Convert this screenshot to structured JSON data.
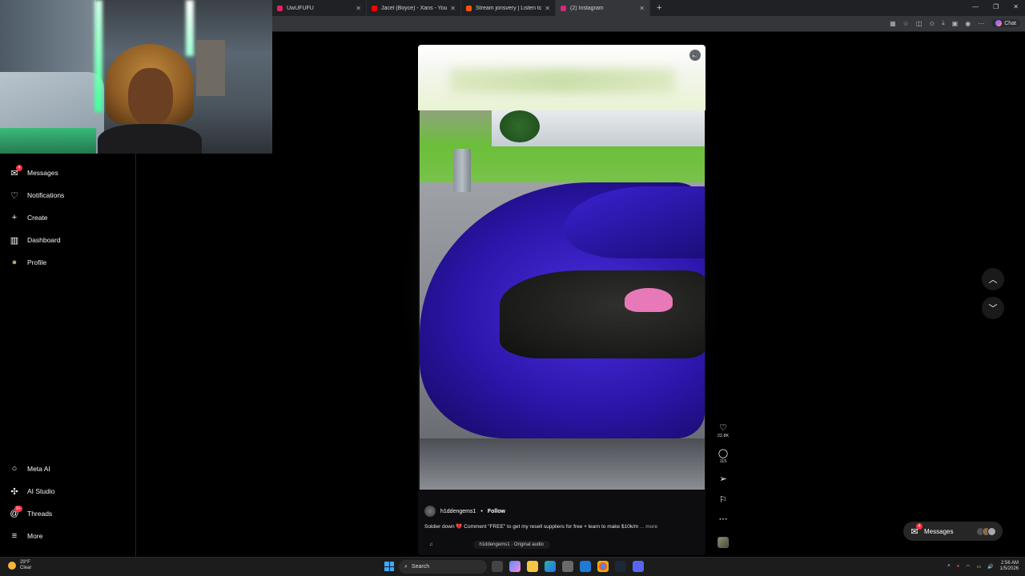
{
  "browser": {
    "tabs": [
      {
        "label": "UwUFUFU",
        "color": "#e0245e",
        "active": false
      },
      {
        "label": "Jacel (Boyce) - Xans - YouTube",
        "color": "#ff0000",
        "active": false
      },
      {
        "label": "Stream jonsvery | Listen to rap pl",
        "color": "#ff5500",
        "active": false
      },
      {
        "label": "(2) Instagram",
        "color": "#d62976",
        "active": true
      }
    ],
    "new_tab_symbol": "+",
    "chat_label": "Chat"
  },
  "sidebar": {
    "items": [
      {
        "label": "Messages",
        "icon": "messenger-icon",
        "glyph": "✉",
        "badge": "4"
      },
      {
        "label": "Notifications",
        "icon": "heart-icon",
        "glyph": "♡",
        "badge": ""
      },
      {
        "label": "Create",
        "icon": "plus-icon",
        "glyph": "+",
        "badge": ""
      },
      {
        "label": "Dashboard",
        "icon": "dashboard-icon",
        "glyph": "▥",
        "badge": ""
      },
      {
        "label": "Profile",
        "icon": "avatar-icon",
        "glyph": "●",
        "badge": ""
      }
    ],
    "bottom_items": [
      {
        "label": "Meta AI",
        "icon": "meta-ai-icon",
        "glyph": "○",
        "badge": ""
      },
      {
        "label": "AI Studio",
        "icon": "ai-studio-icon",
        "glyph": "✣",
        "badge": ""
      },
      {
        "label": "Threads",
        "icon": "threads-icon",
        "glyph": "@",
        "badge": "9+"
      },
      {
        "label": "More",
        "icon": "menu-icon",
        "glyph": "≡",
        "badge": ""
      }
    ]
  },
  "reel": {
    "username": "h1ddengems1",
    "separator": "•",
    "follow_label": "Follow",
    "caption": "Soldier down 💔 Comment \"FREE\" to get my resell suppliers for free + learn to make $10k/m",
    "more_label": "... more",
    "audio_symbol": "♫",
    "audio": "h1ddengems1 · Original audio",
    "likes": "22.8K",
    "comments": "115"
  },
  "messages_pill": {
    "label": "Messages",
    "badge": "4"
  },
  "taskbar": {
    "weather_temp": "29°F",
    "weather_desc": "Clear",
    "search_label": "Search",
    "time": "2:56 AM",
    "date": "1/5/2026"
  }
}
